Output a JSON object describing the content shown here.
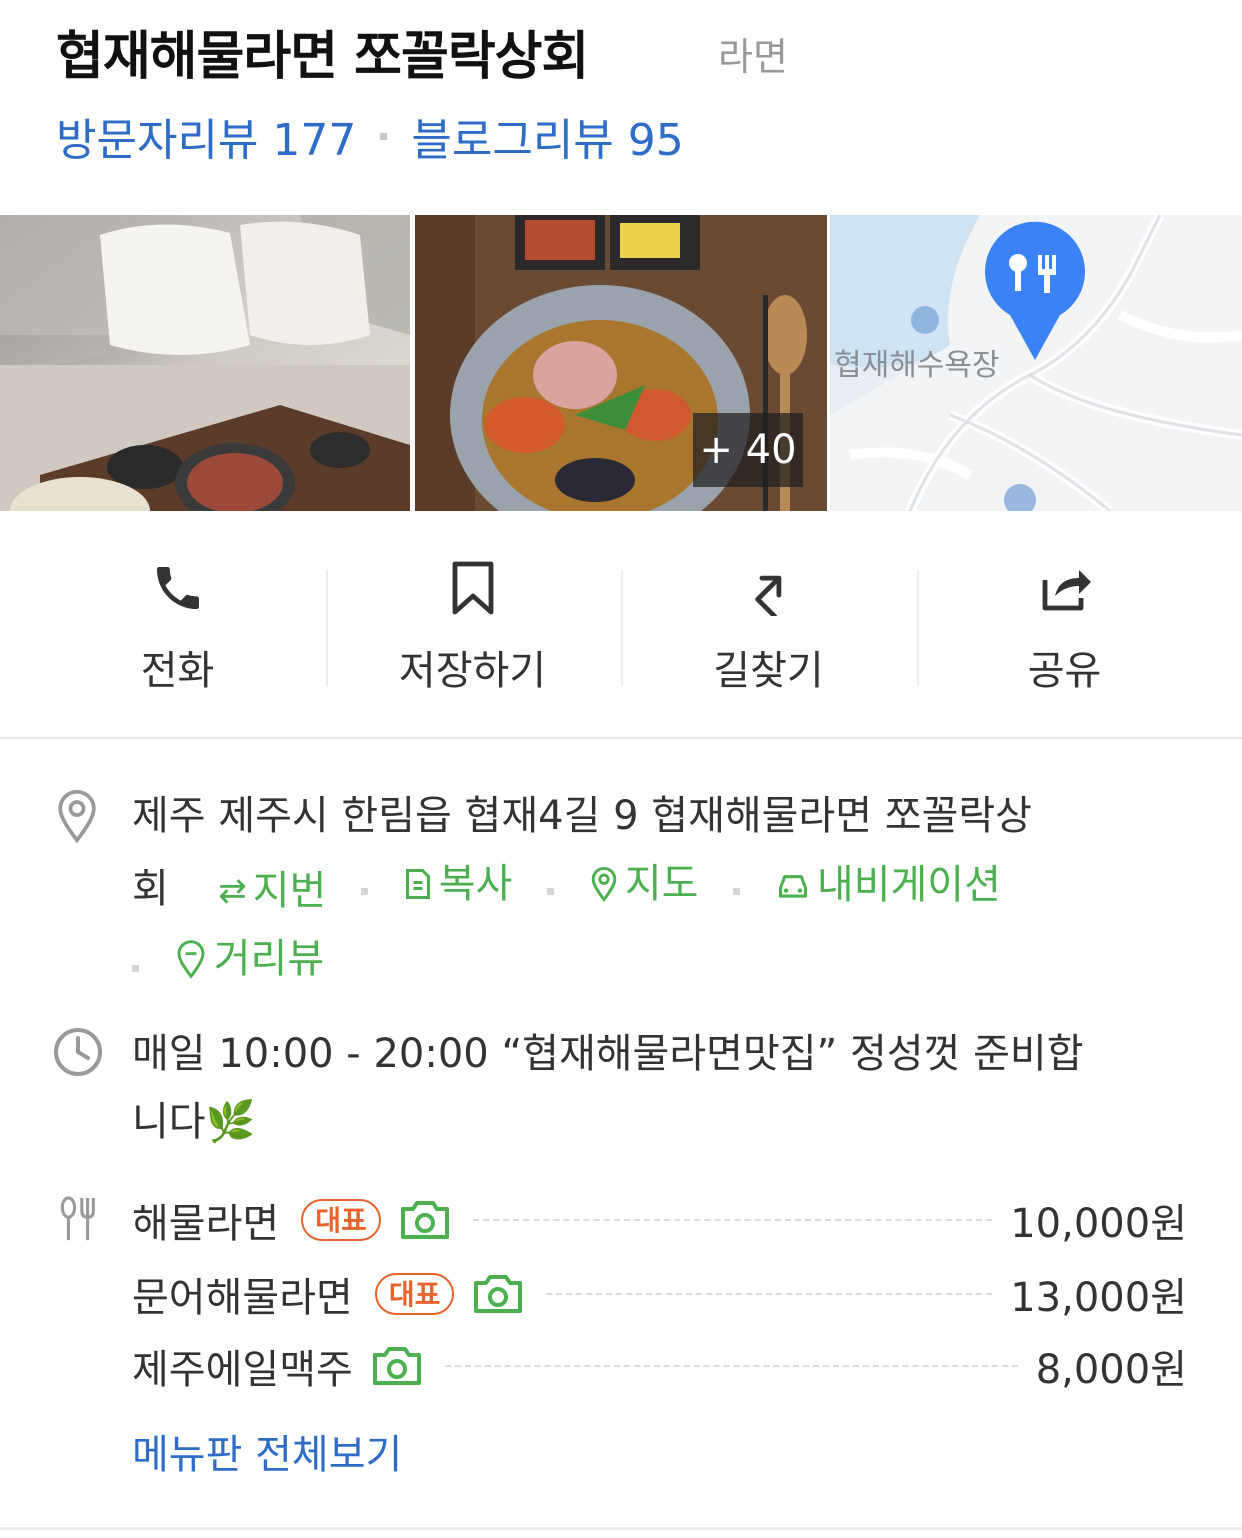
{
  "place": {
    "name": "협재해물라면 쪼꼴락상회",
    "category": "라면",
    "visitor_reviews": "방문자리뷰 177",
    "blog_reviews": "블로그리뷰 95"
  },
  "photos": {
    "more_count": "+ 40",
    "map_label": "협재해수욕장"
  },
  "actions": [
    {
      "label": "전화",
      "icon": "phone-icon"
    },
    {
      "label": "저장하기",
      "icon": "bookmark-icon"
    },
    {
      "label": "길찾기",
      "icon": "directions-icon"
    },
    {
      "label": "공유",
      "icon": "share-icon"
    }
  ],
  "address": {
    "line1": "제주 제주시 한림읍 협재4길 9 협재해물라면 쪼꼴락상",
    "line2_start": "회",
    "links": {
      "jibun": "지번",
      "copy": "복사",
      "map": "지도",
      "navigation": "내비게이션",
      "street_view": "거리뷰"
    }
  },
  "hours": {
    "line1": "매일 10:00 - 20:00 “협재해물라면맛집” 정성껏 준비합",
    "line2": "니다🌿"
  },
  "menu": {
    "items": [
      {
        "name": "해물라면",
        "badge": "대표",
        "price": "10,000원"
      },
      {
        "name": "문어해물라면",
        "badge": "대표",
        "price": "13,000원"
      },
      {
        "name": "제주에일맥주",
        "badge": "",
        "price": "8,000원"
      }
    ],
    "view_all": "메뉴판 전체보기"
  },
  "colors": {
    "link_blue": "#2e6cc7",
    "link_green": "#4cb050",
    "badge_orange": "#e8622b",
    "map_pin": "#3b82f6"
  }
}
